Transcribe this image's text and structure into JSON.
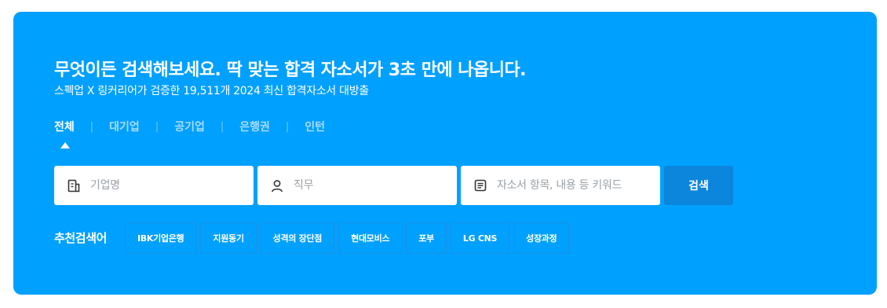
{
  "banner": {
    "headline": "무엇이든 검색해보세요. 딱 맞는 합격 자소서가 3초 만에 나옵니다.",
    "subline": "스펙업 X 링커리어가 검증한 19,511개 2024 최신 합격자소서 대방출",
    "background_color": "#00a0ff"
  },
  "tabs": [
    {
      "label": "전체",
      "active": true
    },
    {
      "label": "대기업",
      "active": false
    },
    {
      "label": "공기업",
      "active": false
    },
    {
      "label": "은행권",
      "active": false
    },
    {
      "label": "인턴",
      "active": false
    }
  ],
  "tab_separator": "|",
  "search": {
    "company_placeholder": "기업명",
    "job_placeholder": "직무",
    "keyword_placeholder": "자소서 항목, 내용 등 키워드",
    "button_label": "검색",
    "button_color": "#0b86dc",
    "icons": {
      "company": "building-icon",
      "job": "person-icon",
      "keyword": "document-icon"
    }
  },
  "recommended": {
    "label": "추천검색어",
    "keywords": [
      "IBK기업은행",
      "지원동기",
      "성격의 장단점",
      "현대모비스",
      "포부",
      "LG CNS",
      "성장과정"
    ]
  }
}
